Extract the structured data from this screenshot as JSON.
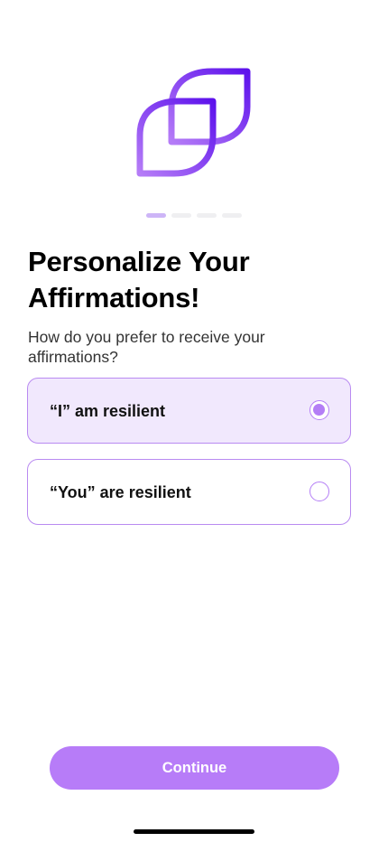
{
  "app": {
    "logo_icon": "tiled-leaf-logo-icon",
    "colors": {
      "accent": "#b77cf8",
      "accent_dark": "#6b1ff0",
      "selected_bg": "#f1e8fd",
      "border": "#b98af1"
    }
  },
  "progress": {
    "total_steps": 4,
    "current_step": 1
  },
  "header": {
    "title": "Personalize Your Affirmations!",
    "subtitle": "How do you prefer to receive your affirmations?"
  },
  "options": [
    {
      "label": "“I” am resilient",
      "selected": true
    },
    {
      "label": "“You” are resilient",
      "selected": false
    }
  ],
  "footer": {
    "continue_label": "Continue"
  }
}
